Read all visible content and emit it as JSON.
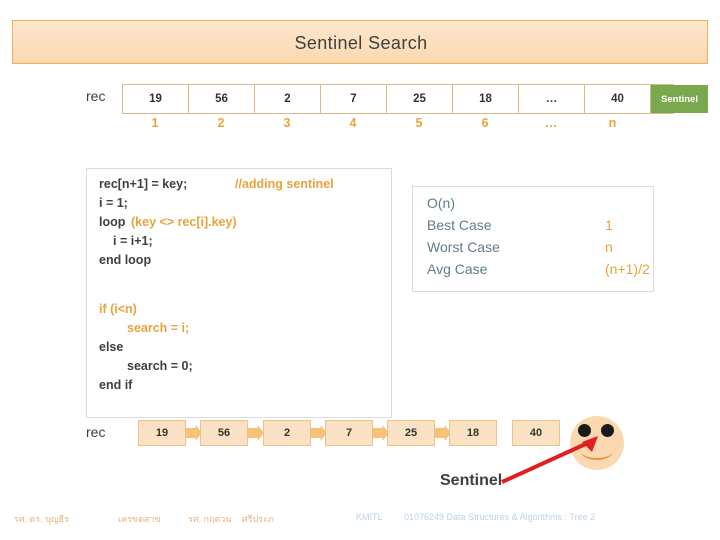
{
  "title": "Sentinel Search",
  "array": {
    "row_label": "rec",
    "cells": [
      "19",
      "56",
      "2",
      "7",
      "25",
      "18",
      "…",
      "40",
      "Sentinel"
    ],
    "indices": [
      "1",
      "2",
      "3",
      "4",
      "5",
      "6",
      "…",
      "n"
    ],
    "sentinel_color": "#7aa84f",
    "index_color": "#e8a33d"
  },
  "code": {
    "lines": [
      "rec[n+1] = key;",
      "i = 1;",
      "loop (key <> rec[i].key)",
      "    i = i+1;",
      "end loop",
      "if (i<n)",
      "    search = i;",
      "else",
      "    search = 0;",
      "end if"
    ],
    "comment": "//adding sentinel",
    "loop_kw": "loop",
    "loop_cond": "(key <> rec[i].key)",
    "if_kw": "if (i<n)",
    "else_kw": "else",
    "endif_kw": "end if",
    "endloop_kw": "end loop",
    "search_i": "search = i;",
    "search_0": "search = 0;",
    "line_i_1": "i = 1;",
    "line_i_inc": "i = i+1;",
    "line_assign": "rec[n+1] = key;"
  },
  "complexity": {
    "heading": "O(n)",
    "rows": [
      {
        "label": "Best Case",
        "value": "1"
      },
      {
        "label": "Worst Case",
        "value": "n"
      },
      {
        "label": "Avg Case",
        "value": "(n+1)/2"
      }
    ]
  },
  "flow": {
    "row_label": "rec",
    "boxes": [
      "19",
      "56",
      "2",
      "7",
      "25",
      "18",
      "40"
    ],
    "caption": "Sentinel"
  },
  "footer": {
    "a": "รศ. ดร. บุญธีร",
    "b": "เครขตสาข",
    "c": "รศ. กฤตวน",
    "d": "ศรีประภ",
    "e": "KMITL",
    "f": "01076249 Data Structures & Algorithms : Tree 2"
  }
}
